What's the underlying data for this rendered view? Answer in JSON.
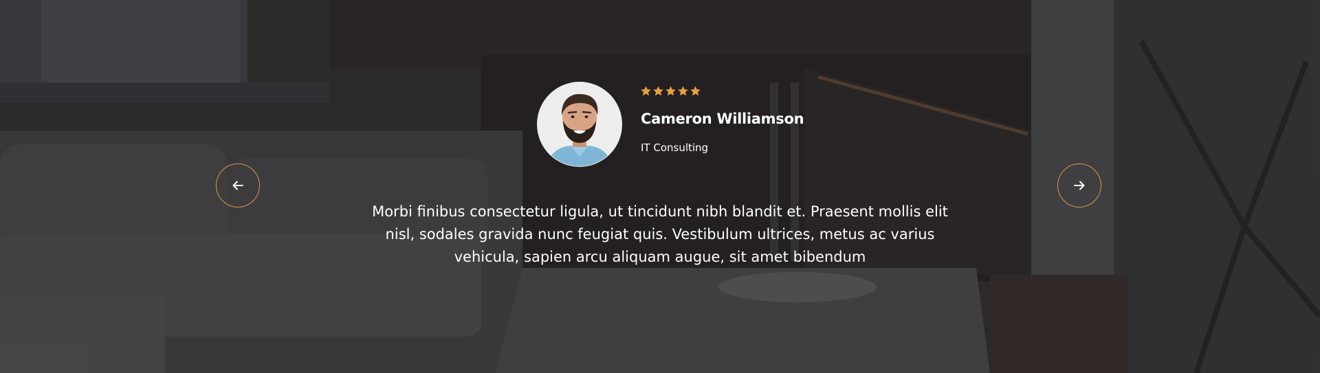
{
  "testimonial": {
    "rating": 5,
    "name": "Cameron Williamson",
    "role": "IT Consulting",
    "quote": "Morbi finibus consectetur ligula, ut tincidunt nibh blandit et. Praesent mollis elit nisl, sodales gravida nunc feugiat quis. Vestibulum ultrices, metus ac varius vehicula, sapien arcu aliquam augue, sit amet bibendum"
  },
  "navigation": {
    "prev_icon": "arrow-left-icon",
    "next_icon": "arrow-right-icon"
  },
  "colors": {
    "accent": "#d69c4e",
    "star": "#e8a23c",
    "text": "#ffffff",
    "overlay": "#1c1c20"
  },
  "icons": {
    "star": "star-icon",
    "avatar": "person-photo"
  }
}
